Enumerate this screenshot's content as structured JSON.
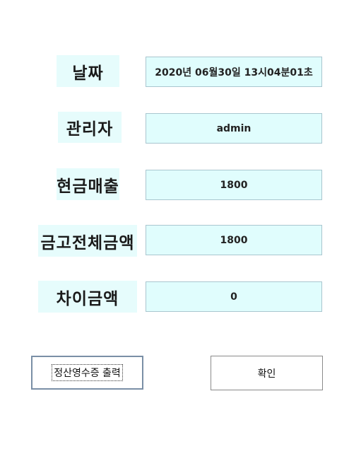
{
  "fields": [
    {
      "label": "날짜",
      "value": "2020년 06월30일 13시04분01초"
    },
    {
      "label": "관리자",
      "value": "admin"
    },
    {
      "label": "현금매출",
      "value": "1800"
    },
    {
      "label": "금고전체금액",
      "value": "1800"
    },
    {
      "label": "차이금액",
      "value": "0"
    }
  ],
  "buttons": {
    "print_receipt": "정산영수증 출력",
    "confirm": "확인"
  }
}
